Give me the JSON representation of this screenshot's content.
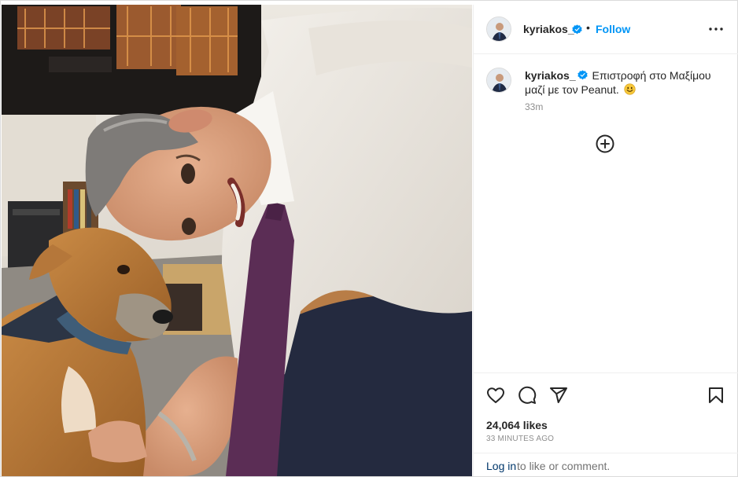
{
  "post": {
    "username": "kyriakos_",
    "follow_label": "Follow",
    "separator": "•",
    "caption_text": "Επιστροφή στο Μαξίμου μαζί με τον Peanut.",
    "caption_emoji": "smiling-face-emoji",
    "time": "33m",
    "likes": "24,064 likes",
    "posted_ago": "33 MINUTES AGO",
    "login_link": "Log in",
    "login_rest": "to like or comment."
  },
  "icons": {
    "verified": "verified-badge-icon",
    "more": "more-options-icon",
    "add_comment": "add-comment-icon",
    "like": "heart-icon",
    "comment": "comment-icon",
    "share": "share-icon",
    "save": "bookmark-icon"
  },
  "colors": {
    "link_blue": "#0095f6",
    "text": "#262626",
    "muted": "#8e8e8e",
    "border": "#dbdbdb"
  }
}
